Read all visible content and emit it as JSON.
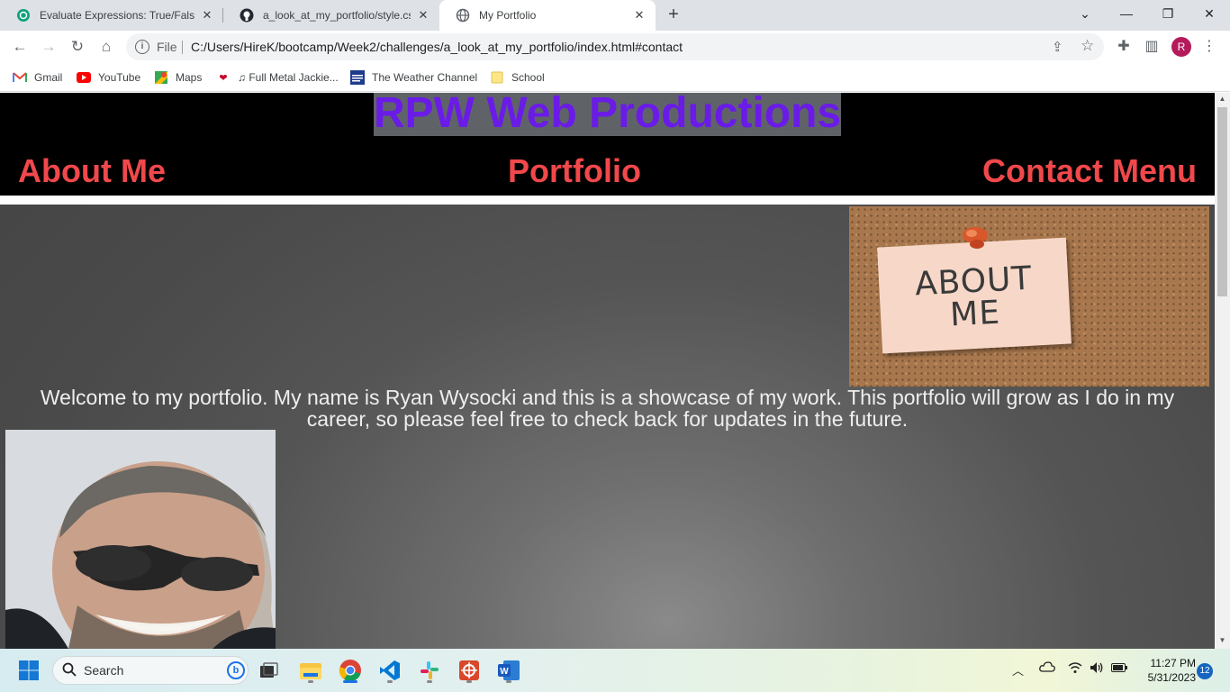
{
  "browser": {
    "tabs": [
      {
        "title": "Evaluate Expressions: True/False",
        "icon": "chatgpt-icon"
      },
      {
        "title": "a_look_at_my_portfolio/style.css",
        "icon": "github-icon"
      },
      {
        "title": "My Portfolio",
        "icon": "globe-icon",
        "active": true
      }
    ],
    "address": {
      "scheme_label": "File",
      "url": "C:/Users/HireK/bootcamp/Week2/challenges/a_look_at_my_portfolio/index.html#contact"
    },
    "profile_initial": "R",
    "bookmarks": [
      {
        "label": "Gmail",
        "icon": "gmail-icon"
      },
      {
        "label": "YouTube",
        "icon": "youtube-icon"
      },
      {
        "label": "Maps",
        "icon": "maps-icon"
      },
      {
        "label": "♫ Full Metal Jackie...",
        "icon": "iheart-icon"
      },
      {
        "label": "The Weather Channel",
        "icon": "weather-channel-icon"
      },
      {
        "label": "School",
        "icon": "folder-icon"
      }
    ]
  },
  "page": {
    "brand": "RPW Web Productions",
    "nav": [
      "About Me",
      "Portfolio",
      "Contact Menu"
    ],
    "about_image_text": "ABOUT ME",
    "welcome": "Welcome to my portfolio. My name is Ryan Wysocki and this is a showcase of my work. This portfolio will grow as I do in my career, so please feel free to check back for updates in the future.",
    "colors": {
      "brand": "#6a1be8",
      "nav": "#f0484b",
      "header_bg": "#000000"
    }
  },
  "taskbar": {
    "search_placeholder": "Search",
    "time": "11:27 PM",
    "date": "5/31/2023",
    "notification_count": "12"
  }
}
